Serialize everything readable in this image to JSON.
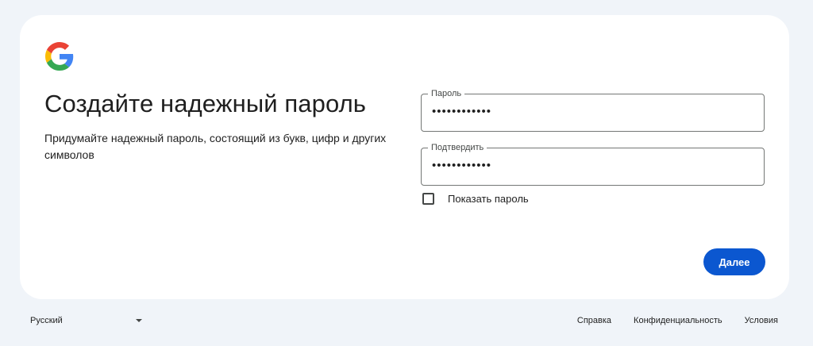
{
  "card": {
    "title": "Создайте надежный пароль",
    "subtitle": "Придумайте надежный пароль, состоящий из букв, цифр и других символов"
  },
  "fields": {
    "password": {
      "label": "Пароль",
      "value": "••••••••••••"
    },
    "confirm": {
      "label": "Подтвердить",
      "value": "••••••••••••"
    }
  },
  "show_password": {
    "label": "Показать пароль",
    "checked": false
  },
  "next_button": {
    "label": "Далее"
  },
  "footer": {
    "language": "Русский",
    "links": [
      "Справка",
      "Конфиденциальность",
      "Условия"
    ]
  },
  "colors": {
    "background": "#f0f4f9",
    "primary": "#0b57d0",
    "google_blue": "#4285F4",
    "google_red": "#EA4335",
    "google_yellow": "#FBBC05",
    "google_green": "#34A853"
  },
  "icons": {
    "logo": "google-g-icon",
    "dropdown": "caret-down-icon"
  }
}
